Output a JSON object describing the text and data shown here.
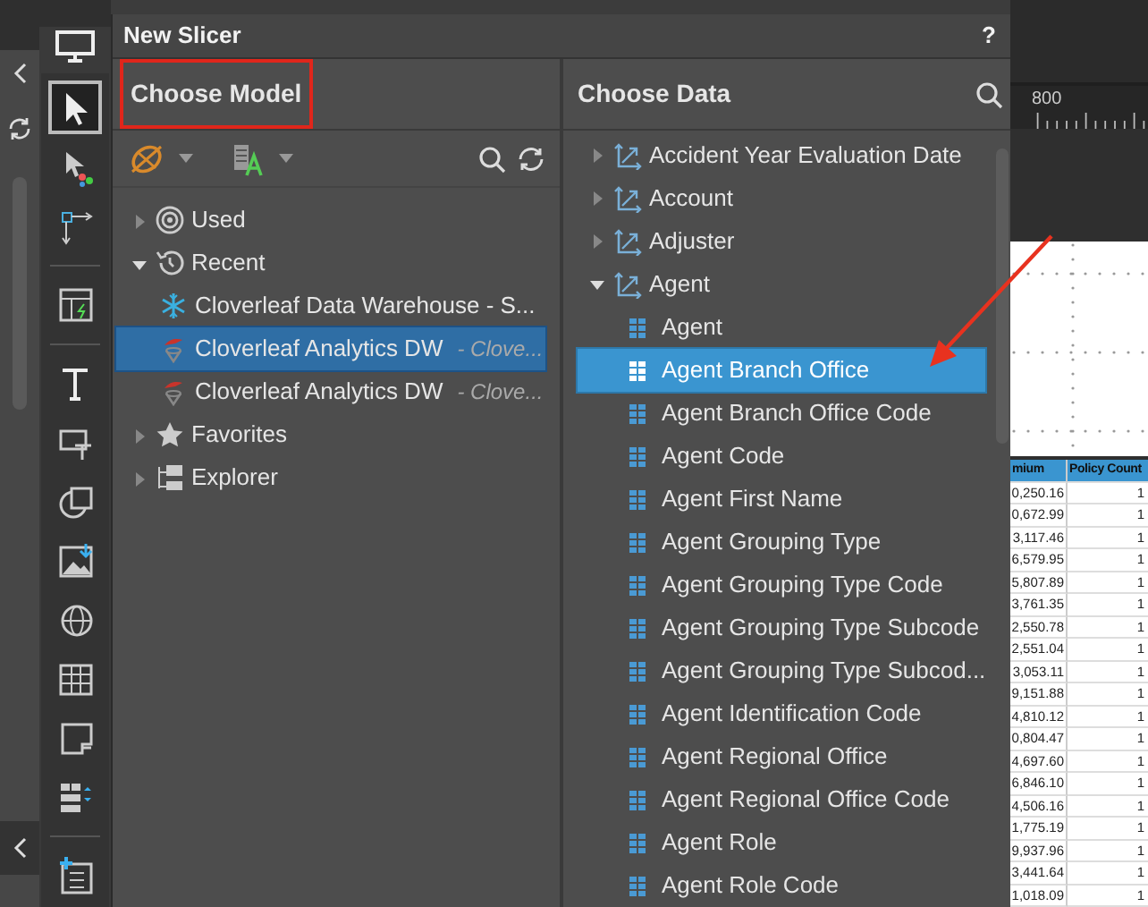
{
  "dialog": {
    "title": "New Slicer",
    "help": "?"
  },
  "model_pane": {
    "title": "Choose Model",
    "tree": [
      {
        "label": "Used",
        "kind": "used",
        "expanded": false
      },
      {
        "label": "Recent",
        "kind": "recent",
        "expanded": true,
        "children": [
          {
            "label": "Cloverleaf Data Warehouse - S...",
            "kind": "warehouse",
            "selected": false
          },
          {
            "label": "Cloverleaf Analytics DW",
            "detail": "- Clove...",
            "kind": "analytics",
            "selected": true
          },
          {
            "label": "Cloverleaf Analytics DW",
            "detail": "- Clove...",
            "kind": "analytics",
            "selected": false
          }
        ]
      },
      {
        "label": "Favorites",
        "kind": "favorites",
        "expanded": false
      },
      {
        "label": "Explorer",
        "kind": "explorer",
        "expanded": false
      }
    ]
  },
  "data_pane": {
    "title": "Choose Data",
    "items": [
      {
        "label": "Accident Year Evaluation Date",
        "expanded": false
      },
      {
        "label": "Account",
        "expanded": false
      },
      {
        "label": "Adjuster",
        "expanded": false
      },
      {
        "label": "Agent",
        "expanded": true,
        "children": [
          {
            "label": "Agent",
            "selected": false
          },
          {
            "label": "Agent Branch Office",
            "selected": true
          },
          {
            "label": "Agent Branch Office Code",
            "selected": false
          },
          {
            "label": "Agent Code",
            "selected": false
          },
          {
            "label": "Agent First Name",
            "selected": false
          },
          {
            "label": "Agent Grouping Type",
            "selected": false
          },
          {
            "label": "Agent Grouping Type Code",
            "selected": false
          },
          {
            "label": "Agent Grouping Type Subcode",
            "selected": false
          },
          {
            "label": "Agent Grouping Type Subcod...",
            "selected": false
          },
          {
            "label": "Agent Identification Code",
            "selected": false
          },
          {
            "label": "Agent Regional Office",
            "selected": false
          },
          {
            "label": "Agent Regional Office Code",
            "selected": false
          },
          {
            "label": "Agent Role",
            "selected": false
          },
          {
            "label": "Agent Role Code",
            "selected": false
          }
        ]
      }
    ]
  },
  "tool_groups": [
    [
      {
        "selected": true
      },
      {
        "selected": false
      },
      {
        "selected": false
      }
    ],
    [
      {
        "selected": false
      }
    ],
    [
      {
        "selected": false
      },
      {
        "selected": false
      },
      {
        "selected": false
      },
      {
        "selected": false
      },
      {
        "selected": false
      },
      {
        "selected": false
      },
      {
        "selected": false
      },
      {
        "selected": false
      }
    ],
    [
      {
        "selected": false
      }
    ]
  ],
  "canvas": {
    "ruler_label": "800",
    "table": {
      "columns": [
        "mium",
        "Policy Count"
      ],
      "rows": [
        [
          "0,250.16",
          "1"
        ],
        [
          "0,672.99",
          "1"
        ],
        [
          "3,117.46",
          "1"
        ],
        [
          "6,579.95",
          "1"
        ],
        [
          "5,807.89",
          "1"
        ],
        [
          "3,761.35",
          "1"
        ],
        [
          "2,550.78",
          "1"
        ],
        [
          "2,551.04",
          "1"
        ],
        [
          "3,053.11",
          "1"
        ],
        [
          "9,151.88",
          "1"
        ],
        [
          "4,810.12",
          "1"
        ],
        [
          "0,804.47",
          "1"
        ],
        [
          "4,697.60",
          "1"
        ],
        [
          "6,846.10",
          "1"
        ],
        [
          "4,506.16",
          "1"
        ],
        [
          "1,775.19",
          "1"
        ],
        [
          "9,937.96",
          "1"
        ],
        [
          "3,441.64",
          "1"
        ],
        [
          "1,018.09",
          "1"
        ]
      ]
    }
  }
}
